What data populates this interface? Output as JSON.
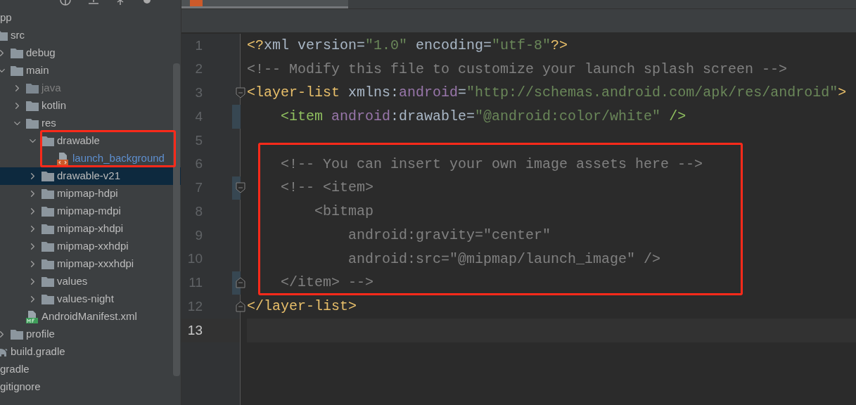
{
  "project_tree": [
    {
      "label": "pp",
      "kind": "entry",
      "selected": false,
      "children": [
        {
          "label": "src",
          "kind": "folder",
          "selected": false,
          "children": [
            {
              "label": "debug",
              "kind": "folder",
              "expanded": false,
              "selected": false
            },
            {
              "label": "main",
              "kind": "folder",
              "expanded": true,
              "selected": false,
              "children": [
                {
                  "label": "java",
                  "kind": "excluded-folder",
                  "expanded": false,
                  "selected": false
                },
                {
                  "label": "kotlin",
                  "kind": "folder",
                  "expanded": false,
                  "selected": false
                },
                {
                  "label": "res",
                  "kind": "folder",
                  "expanded": true,
                  "selected": false,
                  "children": [
                    {
                      "label": "drawable",
                      "kind": "folder",
                      "expanded": true,
                      "selected": false,
                      "children": [
                        {
                          "label": "launch_background",
                          "kind": "xml-file",
                          "selected": false
                        }
                      ]
                    },
                    {
                      "label": "drawable-v21",
                      "kind": "folder",
                      "expanded": false,
                      "selected": true
                    },
                    {
                      "label": "mipmap-hdpi",
                      "kind": "folder",
                      "expanded": false,
                      "selected": false
                    },
                    {
                      "label": "mipmap-mdpi",
                      "kind": "folder",
                      "expanded": false,
                      "selected": false
                    },
                    {
                      "label": "mipmap-xhdpi",
                      "kind": "folder",
                      "expanded": false,
                      "selected": false
                    },
                    {
                      "label": "mipmap-xxhdpi",
                      "kind": "folder",
                      "expanded": false,
                      "selected": false
                    },
                    {
                      "label": "mipmap-xxxhdpi",
                      "kind": "folder",
                      "expanded": false,
                      "selected": false
                    },
                    {
                      "label": "values",
                      "kind": "folder",
                      "expanded": false,
                      "selected": false
                    },
                    {
                      "label": "values-night",
                      "kind": "folder",
                      "expanded": false,
                      "selected": false
                    }
                  ]
                },
                {
                  "label": "AndroidManifest.xml",
                  "kind": "manifest-file",
                  "selected": false
                }
              ]
            },
            {
              "label": "profile",
              "kind": "folder",
              "expanded": false,
              "selected": false
            }
          ]
        },
        {
          "label": "build.gradle",
          "kind": "gradle-file",
          "selected": false
        }
      ]
    },
    {
      "label": "gradle",
      "kind": "entry",
      "selected": false
    },
    {
      "label": "gitignore",
      "kind": "entry",
      "selected": false
    }
  ],
  "editor": {
    "lines": [
      {
        "number": "1",
        "current": false,
        "changed": false,
        "fold_start": false,
        "fold_end": false,
        "tokens": [
          {
            "text": "<?",
            "kind": "tag"
          },
          {
            "text": "xml version=",
            "kind": "plain"
          },
          {
            "text": "\"1.0\"",
            "kind": "value"
          },
          {
            "text": " encoding=",
            "kind": "plain"
          },
          {
            "text": "\"utf-8\"",
            "kind": "value"
          },
          {
            "text": "?>",
            "kind": "tag"
          }
        ]
      },
      {
        "number": "2",
        "current": false,
        "changed": false,
        "fold_start": false,
        "fold_end": false,
        "tokens": [
          {
            "text": "<!-- Modify this file to customize your launch splash screen -->",
            "kind": "comment"
          }
        ]
      },
      {
        "number": "3",
        "current": false,
        "changed": false,
        "fold_start": true,
        "fold_end": false,
        "tokens": [
          {
            "text": "<layer-list",
            "kind": "tag"
          },
          {
            "text": " xmlns:",
            "kind": "plain"
          },
          {
            "text": "android",
            "kind": "ns"
          },
          {
            "text": "=",
            "kind": "plain"
          },
          {
            "text": "\"http://schemas.android.com/apk/res/android\"",
            "kind": "value"
          },
          {
            "text": ">",
            "kind": "tag"
          }
        ]
      },
      {
        "number": "4",
        "current": false,
        "changed": true,
        "fold_start": false,
        "fold_end": false,
        "tokens": [
          {
            "text": "    <item ",
            "kind": "item-tag"
          },
          {
            "text": "android",
            "kind": "ns"
          },
          {
            "text": ":drawable=",
            "kind": "plain"
          },
          {
            "text": "\"@android:color/white\"",
            "kind": "value"
          },
          {
            "text": " />",
            "kind": "item-tag"
          }
        ]
      },
      {
        "number": "5",
        "current": false,
        "changed": false,
        "fold_start": false,
        "fold_end": false
      },
      {
        "number": "6",
        "current": false,
        "changed": false,
        "fold_start": false,
        "fold_end": false,
        "tokens": [
          {
            "text": "    <!-- You can insert your own image assets here -->",
            "kind": "comment"
          }
        ]
      },
      {
        "number": "7",
        "current": false,
        "changed": true,
        "fold_start": true,
        "fold_end": false,
        "tokens": [
          {
            "text": "    <!-- <item>",
            "kind": "comment"
          }
        ]
      },
      {
        "number": "8",
        "current": false,
        "changed": false,
        "fold_start": false,
        "fold_end": false,
        "tokens": [
          {
            "text": "        <bitmap",
            "kind": "comment"
          }
        ]
      },
      {
        "number": "9",
        "current": false,
        "changed": false,
        "fold_start": false,
        "fold_end": false,
        "tokens": [
          {
            "text": "            android:gravity=\"center\"",
            "kind": "comment"
          }
        ]
      },
      {
        "number": "10",
        "current": false,
        "changed": false,
        "fold_start": false,
        "fold_end": false,
        "tokens": [
          {
            "text": "            android:src=\"@mipmap/launch_image\" />",
            "kind": "comment"
          }
        ]
      },
      {
        "number": "11",
        "current": false,
        "changed": true,
        "fold_start": false,
        "fold_end": true,
        "tokens": [
          {
            "text": "    </item> -->",
            "kind": "comment"
          }
        ]
      },
      {
        "number": "12",
        "current": false,
        "changed": false,
        "fold_start": false,
        "fold_end": true,
        "tokens": [
          {
            "text": "</layer-list>",
            "kind": "tag"
          }
        ]
      },
      {
        "number": "13",
        "current": true,
        "changed": false,
        "fold_start": false,
        "fold_end": false
      }
    ]
  }
}
